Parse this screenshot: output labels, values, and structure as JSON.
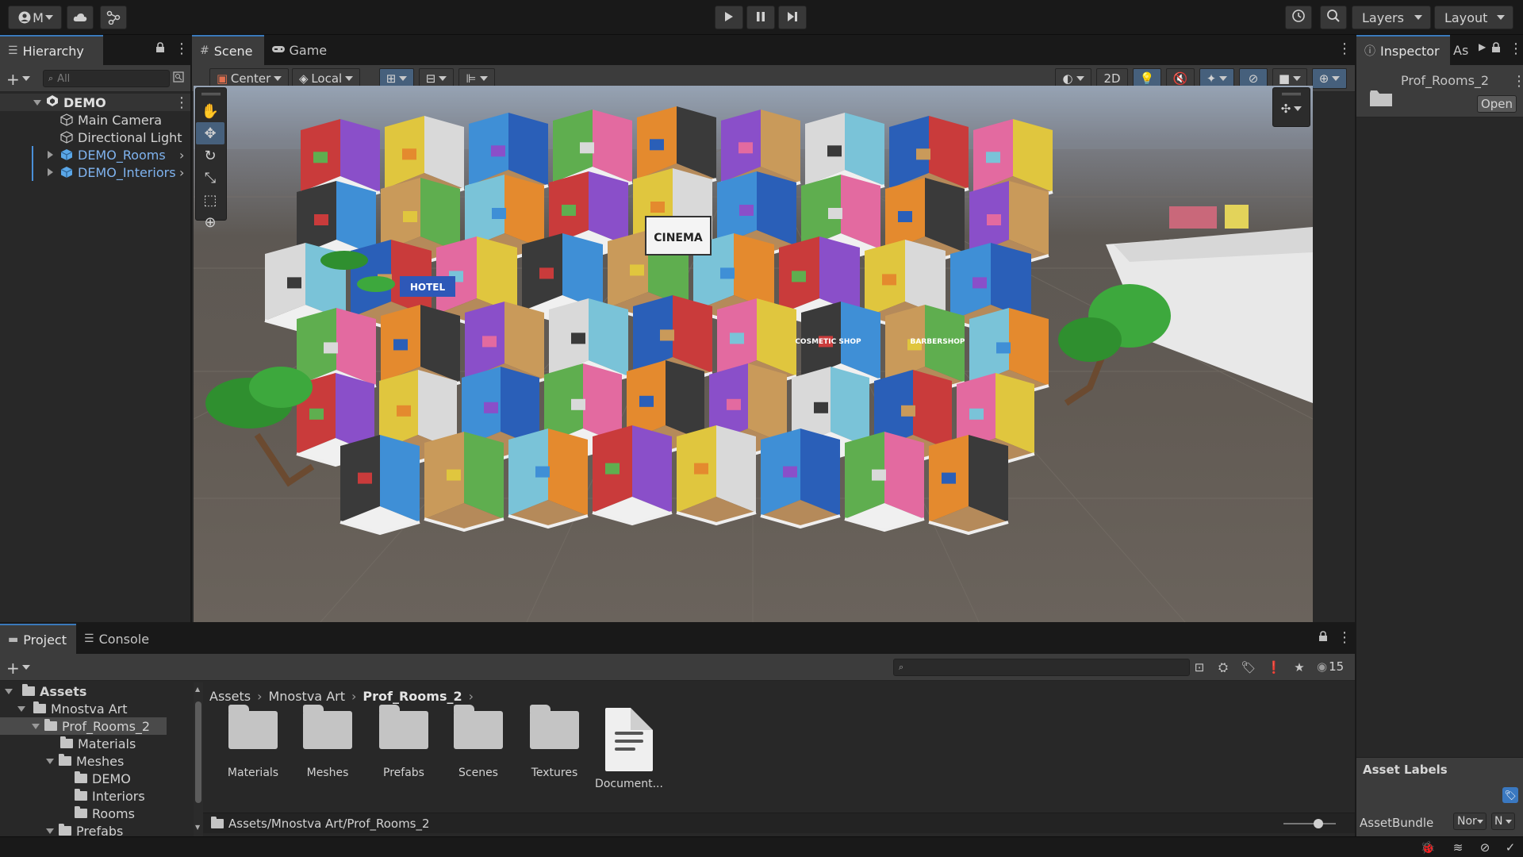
{
  "toolbar": {
    "account_label": "M",
    "layers_label": "Layers",
    "layout_label": "Layout"
  },
  "hierarchy": {
    "tab_label": "Hierarchy",
    "search_placeholder": "All",
    "scene_name": "DEMO",
    "items": [
      {
        "label": "Main Camera"
      },
      {
        "label": "Directional Light"
      },
      {
        "label": "DEMO_Rooms"
      },
      {
        "label": "DEMO_Interiors"
      }
    ]
  },
  "scene": {
    "tabs": [
      {
        "label": "Scene"
      },
      {
        "label": "Game"
      }
    ],
    "pivot_label": "Center",
    "space_label": "Local",
    "mode_2d": "2D"
  },
  "inspector": {
    "tab_label": "Inspector",
    "tab2_label": "As",
    "asset_name": "Prof_Rooms_2",
    "open_label": "Open",
    "asset_labels_title": "Asset Labels",
    "assetbundle_label": "AssetBundle",
    "assetbundle_value": "Nor",
    "assetbundle_variant": "N"
  },
  "project": {
    "tabs": [
      {
        "label": "Project"
      },
      {
        "label": "Console"
      }
    ],
    "visible_count": "15",
    "tree": [
      {
        "label": "Assets"
      },
      {
        "label": "Mnostva Art"
      },
      {
        "label": "Prof_Rooms_2"
      },
      {
        "label": "Materials"
      },
      {
        "label": "Meshes"
      },
      {
        "label": "DEMO"
      },
      {
        "label": "Interiors"
      },
      {
        "label": "Rooms"
      },
      {
        "label": "Prefabs"
      }
    ],
    "breadcrumb": [
      "Assets",
      "Mnostva Art",
      "Prof_Rooms_2"
    ],
    "assets": [
      {
        "label": "Materials"
      },
      {
        "label": "Meshes"
      },
      {
        "label": "Prefabs"
      },
      {
        "label": "Scenes"
      },
      {
        "label": "Textures"
      },
      {
        "label": "Document..."
      }
    ],
    "path": "Assets/Mnostva Art/Prof_Rooms_2"
  },
  "scene_signs": {
    "cinema": "CINEMA",
    "hotel": "HOTEL",
    "cosmetic": "COSMETIC SHOP",
    "barbershop": "BARBERSHOP"
  }
}
